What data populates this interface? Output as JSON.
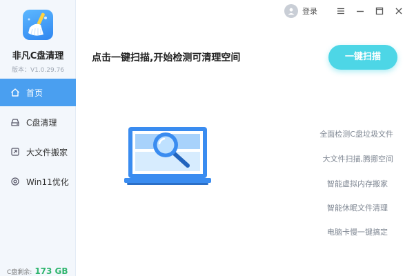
{
  "app": {
    "name": "非凡C盘清理",
    "version": "版本：V1.0.29.76",
    "logo_icon": "broom-icon"
  },
  "topbar": {
    "login_label": "登录",
    "buttons": [
      {
        "icon": "menu-icon"
      },
      {
        "icon": "minimize-icon"
      },
      {
        "icon": "maximize-icon"
      },
      {
        "icon": "close-icon"
      }
    ]
  },
  "sidebar": {
    "items": [
      {
        "label": "首页",
        "icon": "home-icon",
        "active": true
      },
      {
        "label": "C盘清理",
        "icon": "disk-icon",
        "active": false
      },
      {
        "label": "大文件搬家",
        "icon": "move-icon",
        "active": false
      },
      {
        "label": "Win11优化",
        "icon": "optimize-icon",
        "active": false
      }
    ],
    "disk_label": "C盘剩余:",
    "disk_value": "173 GB"
  },
  "main": {
    "headline": "点击一键扫描,开始检测可清理空间",
    "scan_button": "一键扫描",
    "illustration_icon": "laptop-search-icon",
    "features": [
      "全面检测C盘垃圾文件",
      "大文件扫描,腾挪空间",
      "智能虚拟内存搬家",
      "智能休眠文件清理",
      "电脑卡慢一键搞定"
    ]
  },
  "colors": {
    "accent": "#4a9ff0",
    "scan_button": "#4dd6e6",
    "disk_value": "#2fb56e"
  }
}
